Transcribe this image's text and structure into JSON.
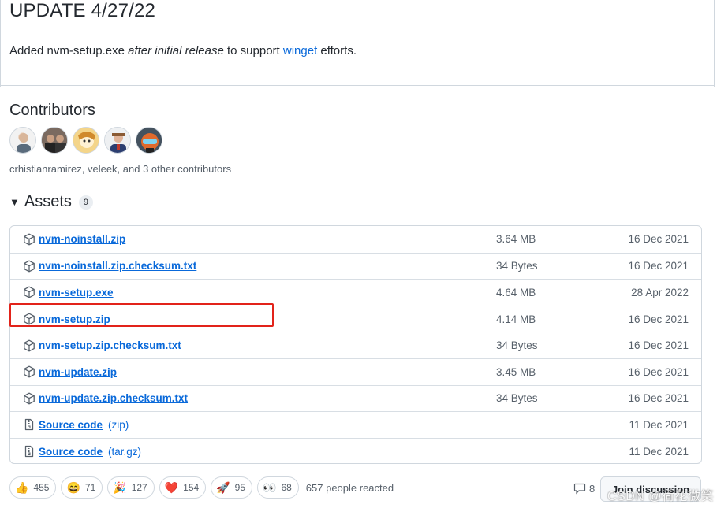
{
  "update": {
    "title": "UPDATE 4/27/22",
    "desc_prefix": "Added nvm-setup.exe ",
    "desc_italic": "after initial release",
    "desc_mid": " to support ",
    "desc_link": "winget",
    "desc_suffix": " efforts."
  },
  "contributors": {
    "title": "Contributors",
    "summary": "crhistianramirez, veleek, and 3 other contributors",
    "avatars": [
      "avatar-1",
      "avatar-2",
      "avatar-3",
      "avatar-4",
      "avatar-5"
    ]
  },
  "assets": {
    "title": "Assets",
    "count": "9",
    "items": [
      {
        "name": "nvm-noinstall.zip",
        "size": "3.64 MB",
        "date": "16 Dec 2021",
        "icon": "package-icon"
      },
      {
        "name": "nvm-noinstall.zip.checksum.txt",
        "size": "34 Bytes",
        "date": "16 Dec 2021",
        "icon": "package-icon"
      },
      {
        "name": "nvm-setup.exe",
        "size": "4.64 MB",
        "date": "28 Apr 2022",
        "icon": "package-icon"
      },
      {
        "name": "nvm-setup.zip",
        "size": "4.14 MB",
        "date": "16 Dec 2021",
        "icon": "package-icon"
      },
      {
        "name": "nvm-setup.zip.checksum.txt",
        "size": "34 Bytes",
        "date": "16 Dec 2021",
        "icon": "package-icon"
      },
      {
        "name": "nvm-update.zip",
        "size": "3.45 MB",
        "date": "16 Dec 2021",
        "icon": "package-icon"
      },
      {
        "name": "nvm-update.zip.checksum.txt",
        "size": "34 Bytes",
        "date": "16 Dec 2021",
        "icon": "package-icon"
      },
      {
        "name": "Source code",
        "sub": "(zip)",
        "size": "",
        "date": "11 Dec 2021",
        "icon": "file-zip-icon"
      },
      {
        "name": "Source code",
        "sub": "(tar.gz)",
        "size": "",
        "date": "11 Dec 2021",
        "icon": "file-zip-icon"
      }
    ]
  },
  "reactions": {
    "items": [
      {
        "emoji": "👍",
        "icon": "thumbs-up-icon",
        "count": "455"
      },
      {
        "emoji": "😄",
        "icon": "laugh-icon",
        "count": "71"
      },
      {
        "emoji": "🎉",
        "icon": "hooray-icon",
        "count": "127"
      },
      {
        "emoji": "❤️",
        "icon": "heart-icon",
        "count": "154"
      },
      {
        "emoji": "🚀",
        "icon": "rocket-icon",
        "count": "95"
      },
      {
        "emoji": "👀",
        "icon": "eyes-icon",
        "count": "68"
      }
    ],
    "summary": "657 people reacted"
  },
  "discussion": {
    "comment_count": "8",
    "join_label": "Join discussion"
  },
  "watermark": "CSDN @荷花微笑",
  "colors": {
    "link": "#0969da",
    "highlight": "#e2231a",
    "border": "#d0d7de"
  }
}
